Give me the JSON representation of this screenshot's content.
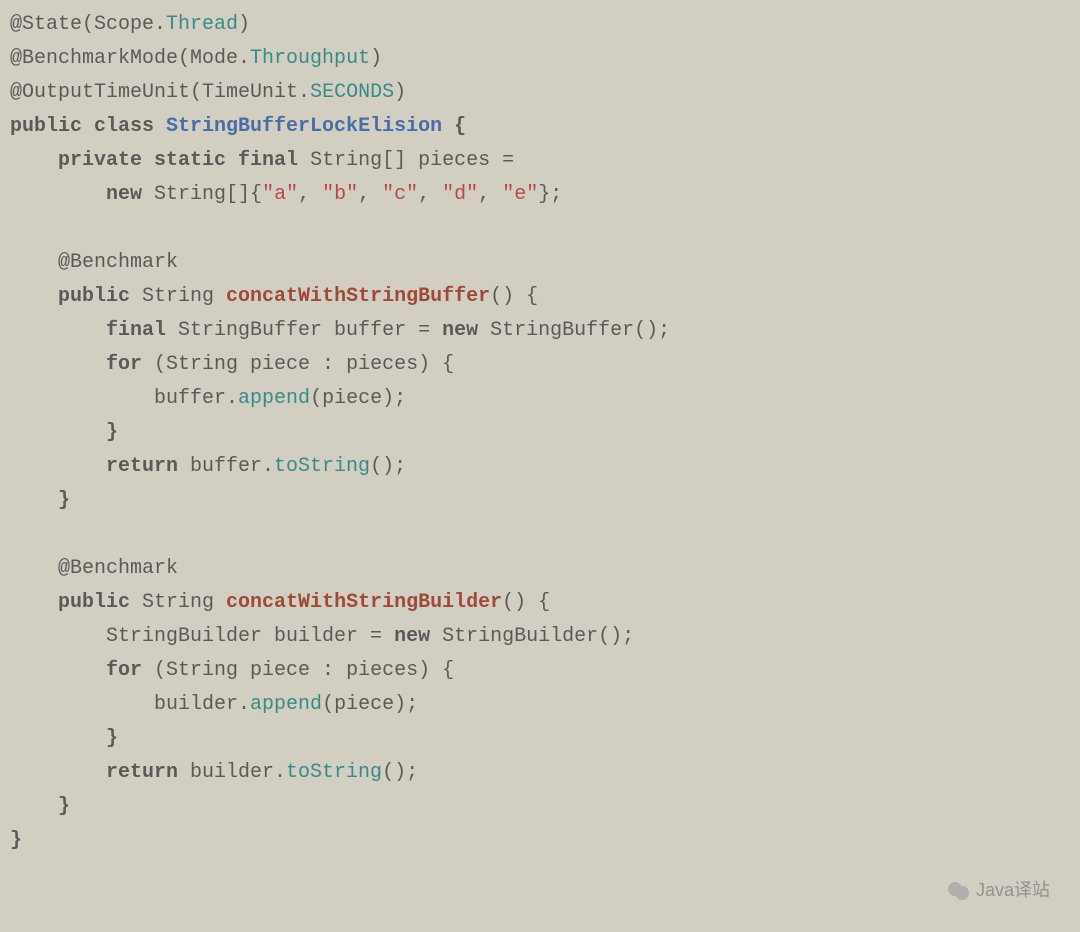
{
  "code": {
    "line1": {
      "ann": "@State",
      "p1": "(Scope.",
      "const": "Thread",
      "p2": ")"
    },
    "line2": {
      "ann": "@BenchmarkMode",
      "p1": "(Mode.",
      "const": "Throughput",
      "p2": ")"
    },
    "line3": {
      "ann": "@OutputTimeUnit",
      "p1": "(TimeUnit.",
      "const": "SECONDS",
      "p2": ")"
    },
    "line4": {
      "kw1": "public class ",
      "cls": "StringBufferLockElision",
      "brace": " {"
    },
    "line5": {
      "indent": "    ",
      "kw": "private static final ",
      "rest": "String[] pieces ="
    },
    "line6": {
      "indent": "        ",
      "kw": "new ",
      "t": "String[]{",
      "s1": "\"a\"",
      "c1": ", ",
      "s2": "\"b\"",
      "c2": ", ",
      "s3": "\"c\"",
      "c3": ", ",
      "s4": "\"d\"",
      "c4": ", ",
      "s5": "\"e\"",
      "end": "};"
    },
    "line8": {
      "indent": "    ",
      "ann": "@Benchmark"
    },
    "line9": {
      "indent": "    ",
      "kw": "public ",
      "t": "String ",
      "m": "concatWithStringBuffer",
      "end": "() {"
    },
    "line10": {
      "indent": "        ",
      "kw1": "final ",
      "t1": "StringBuffer buffer = ",
      "kw2": "new ",
      "t2": "StringBuffer();"
    },
    "line11": {
      "indent": "        ",
      "kw": "for ",
      "rest": "(String piece : pieces) {"
    },
    "line12": {
      "indent": "            ",
      "obj": "buffer.",
      "call": "append",
      "end": "(piece);"
    },
    "line13": {
      "indent": "        ",
      "brace": "}"
    },
    "line14": {
      "indent": "        ",
      "kw": "return ",
      "obj": "buffer.",
      "call": "toString",
      "end": "();"
    },
    "line15": {
      "indent": "    ",
      "brace": "}"
    },
    "line17": {
      "indent": "    ",
      "ann": "@Benchmark"
    },
    "line18": {
      "indent": "    ",
      "kw": "public ",
      "t": "String ",
      "m": "concatWithStringBuilder",
      "end": "() {"
    },
    "line19": {
      "indent": "        ",
      "t1": "StringBuilder builder = ",
      "kw": "new ",
      "t2": "StringBuilder();"
    },
    "line20": {
      "indent": "        ",
      "kw": "for ",
      "rest": "(String piece : pieces) {"
    },
    "line21": {
      "indent": "            ",
      "obj": "builder.",
      "call": "append",
      "end": "(piece);"
    },
    "line22": {
      "indent": "        ",
      "brace": "}"
    },
    "line23": {
      "indent": "        ",
      "kw": "return ",
      "obj": "builder.",
      "call": "toString",
      "end": "();"
    },
    "line24": {
      "indent": "    ",
      "brace": "}"
    },
    "line25": {
      "brace": "}"
    }
  },
  "watermark": {
    "text": "Java译站"
  }
}
